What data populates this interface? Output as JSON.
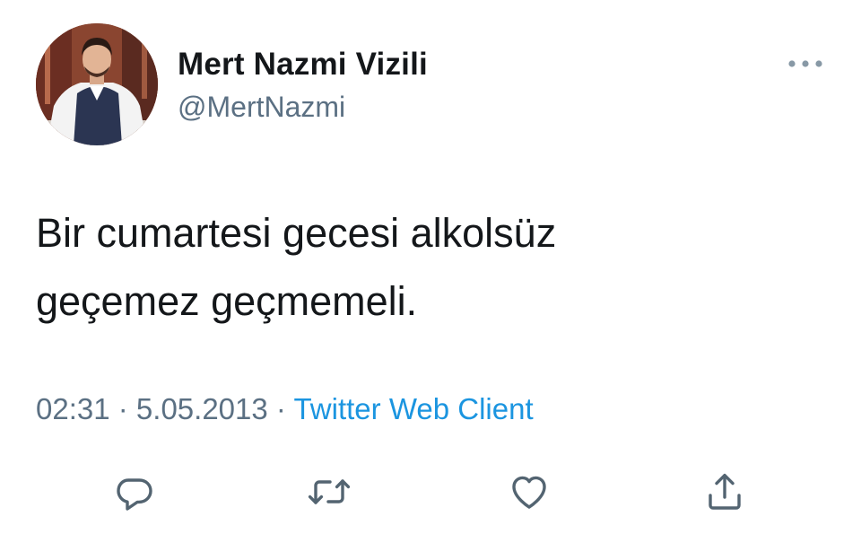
{
  "tweet": {
    "author": {
      "display_name": "Mert Nazmi Vizili",
      "handle": "@MertNazmi",
      "avatar_icon": "profile-photo"
    },
    "more_icon": "more-horizontal-icon",
    "text": "Bir cumartesi gecesi alkolsüz\ngeçemez geçmemeli.",
    "meta": {
      "time": "02:31",
      "separator1": " · ",
      "date": "5.05.2013",
      "separator2": " · ",
      "source": "Twitter Web Client"
    },
    "actions": [
      {
        "name": "reply",
        "icon": "reply-icon"
      },
      {
        "name": "retweet",
        "icon": "retweet-icon"
      },
      {
        "name": "like",
        "icon": "heart-icon"
      },
      {
        "name": "share",
        "icon": "share-icon"
      }
    ],
    "colors": {
      "text": "#14171a",
      "secondary": "#5b7083",
      "link": "#1b95e0",
      "icon": "#536471"
    }
  }
}
